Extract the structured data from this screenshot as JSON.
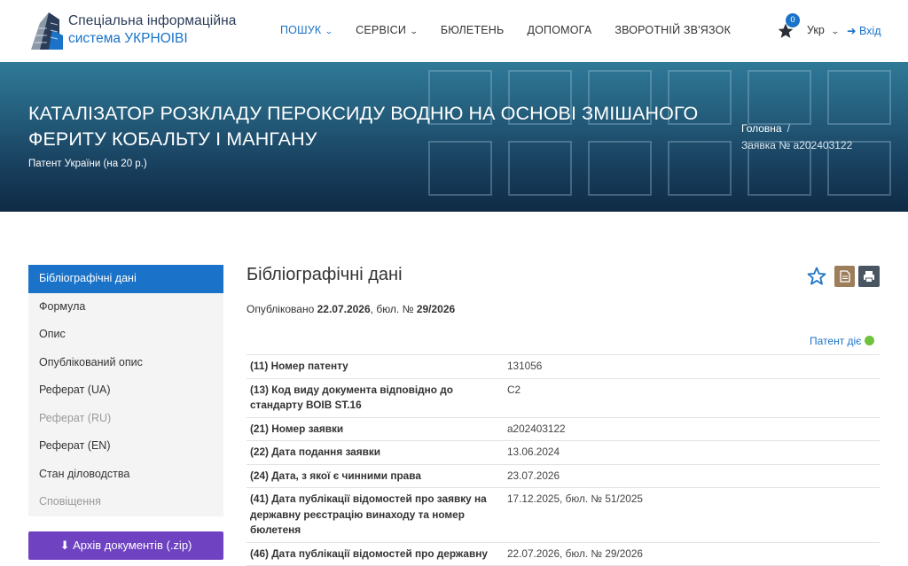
{
  "header": {
    "logo_line1": "Спеціальна інформаційна",
    "logo_line2": "система УКРНОІВІ",
    "nav": [
      {
        "label": "ПОШУК",
        "has_dropdown": true,
        "active": true
      },
      {
        "label": "СЕРВІСИ",
        "has_dropdown": true,
        "active": false
      },
      {
        "label": "БЮЛЕТЕНЬ",
        "has_dropdown": false,
        "active": false
      },
      {
        "label": "ДОПОМОГА",
        "has_dropdown": false,
        "active": false
      },
      {
        "label": "ЗВОРОТНІЙ ЗВ'ЯЗОК",
        "has_dropdown": false,
        "active": false
      }
    ],
    "favorites_icon": "star-icon",
    "favorites_count": "0",
    "language": "Укр",
    "login_label": "Вхід"
  },
  "hero": {
    "title": "КАТАЛІЗАТОР РОЗКЛАДУ ПЕРОКСИДУ ВОДНЮ НА ОСНОВІ ЗМІШАНОГО ФЕРИТУ КОБАЛЬТУ І МАНГАНУ",
    "subtitle": "Патент України (на 20 р.)",
    "breadcrumb_home": "Головна",
    "breadcrumb_sep": "/",
    "breadcrumb_current": "Заявка № a202403122"
  },
  "sidebar": {
    "items": [
      {
        "label": "Бібліографічні дані",
        "state": "active"
      },
      {
        "label": "Формула",
        "state": "normal"
      },
      {
        "label": "Опис",
        "state": "normal"
      },
      {
        "label": "Опублікований опис",
        "state": "normal"
      },
      {
        "label": "Реферат (UA)",
        "state": "normal"
      },
      {
        "label": "Реферат (RU)",
        "state": "disabled"
      },
      {
        "label": "Реферат (EN)",
        "state": "normal"
      },
      {
        "label": "Стан діловодства",
        "state": "normal"
      },
      {
        "label": "Сповіщення",
        "state": "disabled"
      }
    ],
    "archive_button": "Архів документів (.zip)"
  },
  "main": {
    "title": "Бібліографічні дані",
    "published_prefix": "Опубліковано",
    "published_date": "22.07.2026",
    "published_bulletin_prefix": ", бюл. №",
    "published_bulletin": "29/2026",
    "status_label": "Патент діє",
    "status_color": "#6fc23c",
    "rows": [
      {
        "key": "(11) Номер патенту",
        "value": "131056"
      },
      {
        "key": "(13) Код виду документа відповідно до стандарту ВОІВ ST.16",
        "value": "C2"
      },
      {
        "key": "(21) Номер заявки",
        "value": "a202403122"
      },
      {
        "key": "(22) Дата подання заявки",
        "value": "13.06.2024"
      },
      {
        "key": "(24) Дата, з якої є чинними права",
        "value": "23.07.2026"
      },
      {
        "key": "(41) Дата публікації відомостей про заявку на державну реєстрацію винаходу та номер бюлетеня",
        "value": "17.12.2025, бюл. № 51/2025"
      },
      {
        "key": "(46) Дата публікації відомостей про державну",
        "value": "22.07.2026, бюл. № 29/2026"
      }
    ]
  },
  "colors": {
    "accent": "#1a73c9",
    "archive_button": "#6f42c1",
    "doc_button": "#9c7e5b",
    "print_button": "#4a5562"
  }
}
